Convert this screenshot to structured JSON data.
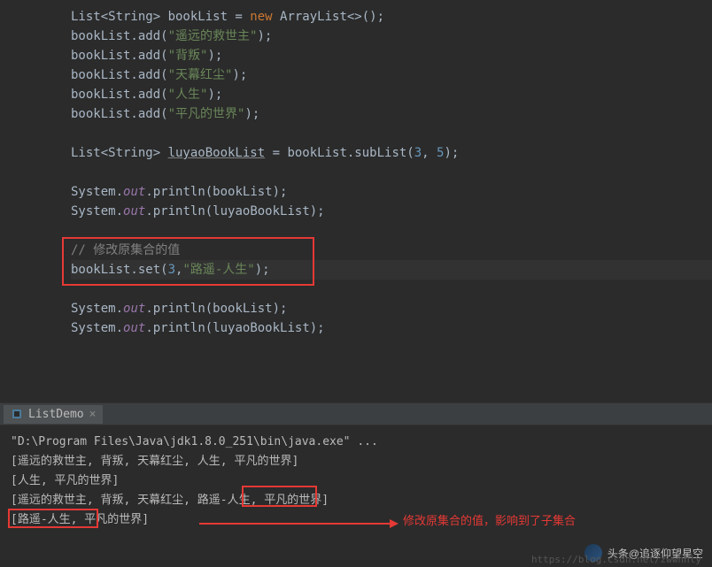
{
  "code": {
    "l1": "List<String> bookList = new ArrayList<>();",
    "l2a": "bookList.add(",
    "l2s": "\"遥远的救世主\"",
    "l2b": ");",
    "l3s": "\"背叛\"",
    "l4s": "\"天幕红尘\"",
    "l5s": "\"人生\"",
    "l6s": "\"平凡的世界\"",
    "l8a": "List<String> ",
    "l8var": "luyaoBookList",
    "l8b": " = bookList.subList(",
    "l8n1": "3",
    "l8c": ", ",
    "l8n2": "5",
    "l8d": ");",
    "l10a": "System.",
    "l10f": "out",
    "l10b": ".println(bookList);",
    "l11b": ".println(luyaoBookList);",
    "l13": "// 修改原集合的值",
    "l14a": "bookList.set(",
    "l14n": "3",
    "l14c": ",",
    "l14s": "\"路遥-人生\"",
    "l14b": ");"
  },
  "tab": {
    "label": "ListDemo",
    "close": "×"
  },
  "console": {
    "l1": "\"D:\\Program Files\\Java\\jdk1.8.0_251\\bin\\java.exe\" ...",
    "l2": "[遥远的救世主, 背叛, 天幕红尘, 人生, 平凡的世界]",
    "l3": "[人生, 平凡的世界]",
    "l4": "[遥远的救世主, 背叛, 天幕红尘, 路遥-人生, 平凡的世界]",
    "l5": "[路遥-人生, 平凡的世界]",
    "annotation": "修改原集合的值，影响到了子集合"
  },
  "watermark": {
    "text": "头条@追逐仰望星空",
    "url": "https://blog.csdn.net/zwwhnly"
  }
}
